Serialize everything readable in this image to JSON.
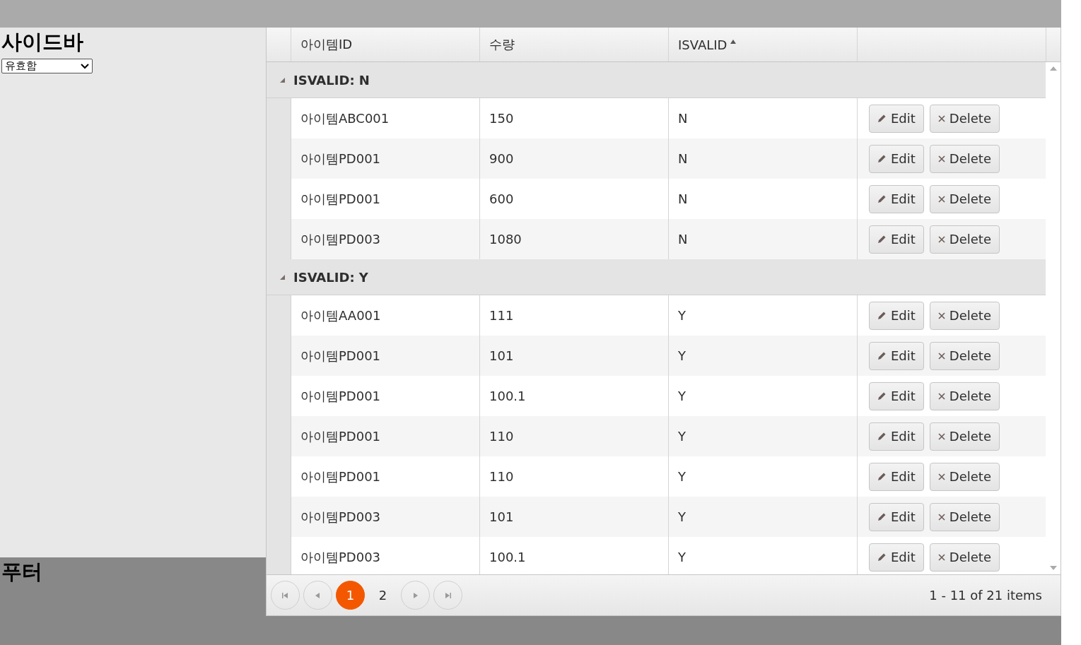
{
  "sidebar": {
    "title": "사이드바",
    "select": {
      "value": "유효함"
    }
  },
  "footer": {
    "title": "푸터"
  },
  "columns": [
    {
      "label": "아이템ID",
      "sorted": false
    },
    {
      "label": "수량",
      "sorted": false
    },
    {
      "label": "ISVALID",
      "sorted": true
    }
  ],
  "groups": [
    {
      "label": "ISVALID: N",
      "expanded": true,
      "rows": [
        {
          "item_id": "아이템ABC001",
          "quantity": "150",
          "isvalid": "N",
          "edit": "Edit",
          "delete": "Delete"
        },
        {
          "item_id": "아이템PD001",
          "quantity": "900",
          "isvalid": "N",
          "edit": "Edit",
          "delete": "Delete"
        },
        {
          "item_id": "아이템PD001",
          "quantity": "600",
          "isvalid": "N",
          "edit": "Edit",
          "delete": "Delete"
        },
        {
          "item_id": "아이템PD003",
          "quantity": "1080",
          "isvalid": "N",
          "edit": "Edit",
          "delete": "Delete"
        }
      ]
    },
    {
      "label": "ISVALID: Y",
      "expanded": true,
      "rows": [
        {
          "item_id": "아이템AA001",
          "quantity": "111",
          "isvalid": "Y",
          "edit": "Edit",
          "delete": "Delete"
        },
        {
          "item_id": "아이템PD001",
          "quantity": "101",
          "isvalid": "Y",
          "edit": "Edit",
          "delete": "Delete"
        },
        {
          "item_id": "아이템PD001",
          "quantity": "100.1",
          "isvalid": "Y",
          "edit": "Edit",
          "delete": "Delete"
        },
        {
          "item_id": "아이템PD001",
          "quantity": "110",
          "isvalid": "Y",
          "edit": "Edit",
          "delete": "Delete"
        },
        {
          "item_id": "아이템PD001",
          "quantity": "110",
          "isvalid": "Y",
          "edit": "Edit",
          "delete": "Delete"
        },
        {
          "item_id": "아이템PD003",
          "quantity": "101",
          "isvalid": "Y",
          "edit": "Edit",
          "delete": "Delete"
        },
        {
          "item_id": "아이템PD003",
          "quantity": "100.1",
          "isvalid": "Y",
          "edit": "Edit",
          "delete": "Delete"
        }
      ]
    }
  ],
  "pager": {
    "pages": [
      {
        "label": "1",
        "selected": true
      },
      {
        "label": "2",
        "selected": false
      }
    ],
    "info": "1 - 11 of 21 items"
  }
}
